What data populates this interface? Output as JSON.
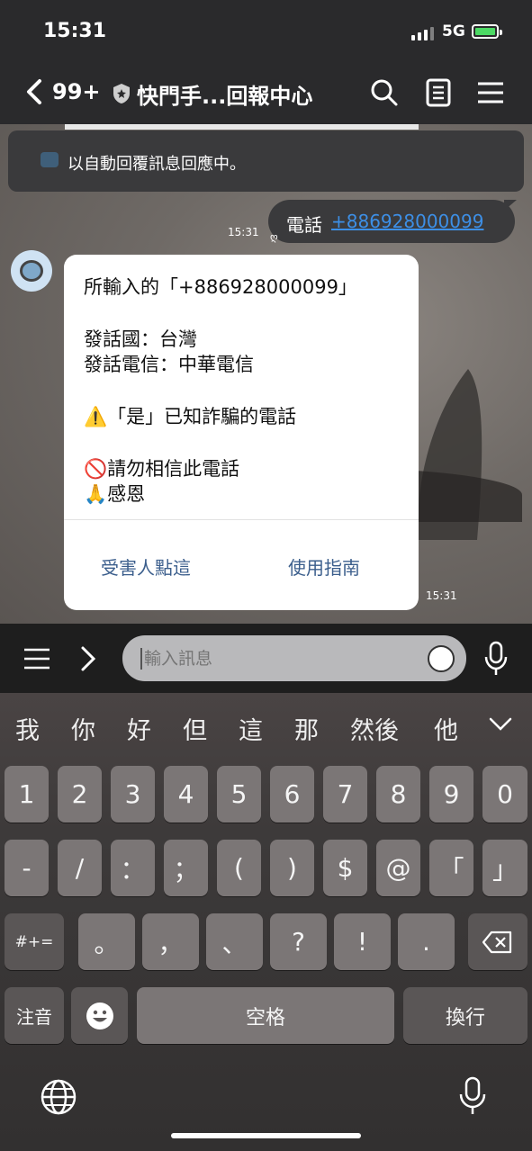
{
  "status": {
    "time": "15:31",
    "network": "5G"
  },
  "nav": {
    "back_count": "99+",
    "title": "快門手...回報中心"
  },
  "chat": {
    "auto_reply": "以自動回覆訊息回應中。",
    "outgoing": {
      "label": "電話",
      "phone": "+886928000099",
      "time": "15:31",
      "read_mark": "ღ"
    },
    "incoming": {
      "lines": [
        "所輸入的「+886928000099」",
        "發話國：台灣",
        "發話電信：中華電信",
        "⚠️「是」已知詐騙的電話",
        "🚫請勿相信此電話",
        "🙏感恩"
      ],
      "actions": [
        "受害人點這",
        "使用指南"
      ],
      "time": "15:31"
    }
  },
  "input": {
    "placeholder": "輸入訊息"
  },
  "keyboard": {
    "suggestions": [
      "我",
      "你",
      "好",
      "但",
      "這",
      "那",
      "然後",
      "他"
    ],
    "row1": [
      "1",
      "2",
      "3",
      "4",
      "5",
      "6",
      "7",
      "8",
      "9",
      "0"
    ],
    "row2": [
      "-",
      "/",
      "：",
      "；",
      "(",
      ")",
      "$",
      "@",
      "「",
      "」"
    ],
    "row3": [
      "#+=",
      "。",
      "，",
      "、",
      "?",
      "!",
      "."
    ],
    "zhuyin": "注音",
    "space": "空格",
    "return": "換行"
  },
  "colors": {
    "link": "#3d8fe6",
    "action": "#3b5e8c",
    "battery": "#4cd964"
  }
}
